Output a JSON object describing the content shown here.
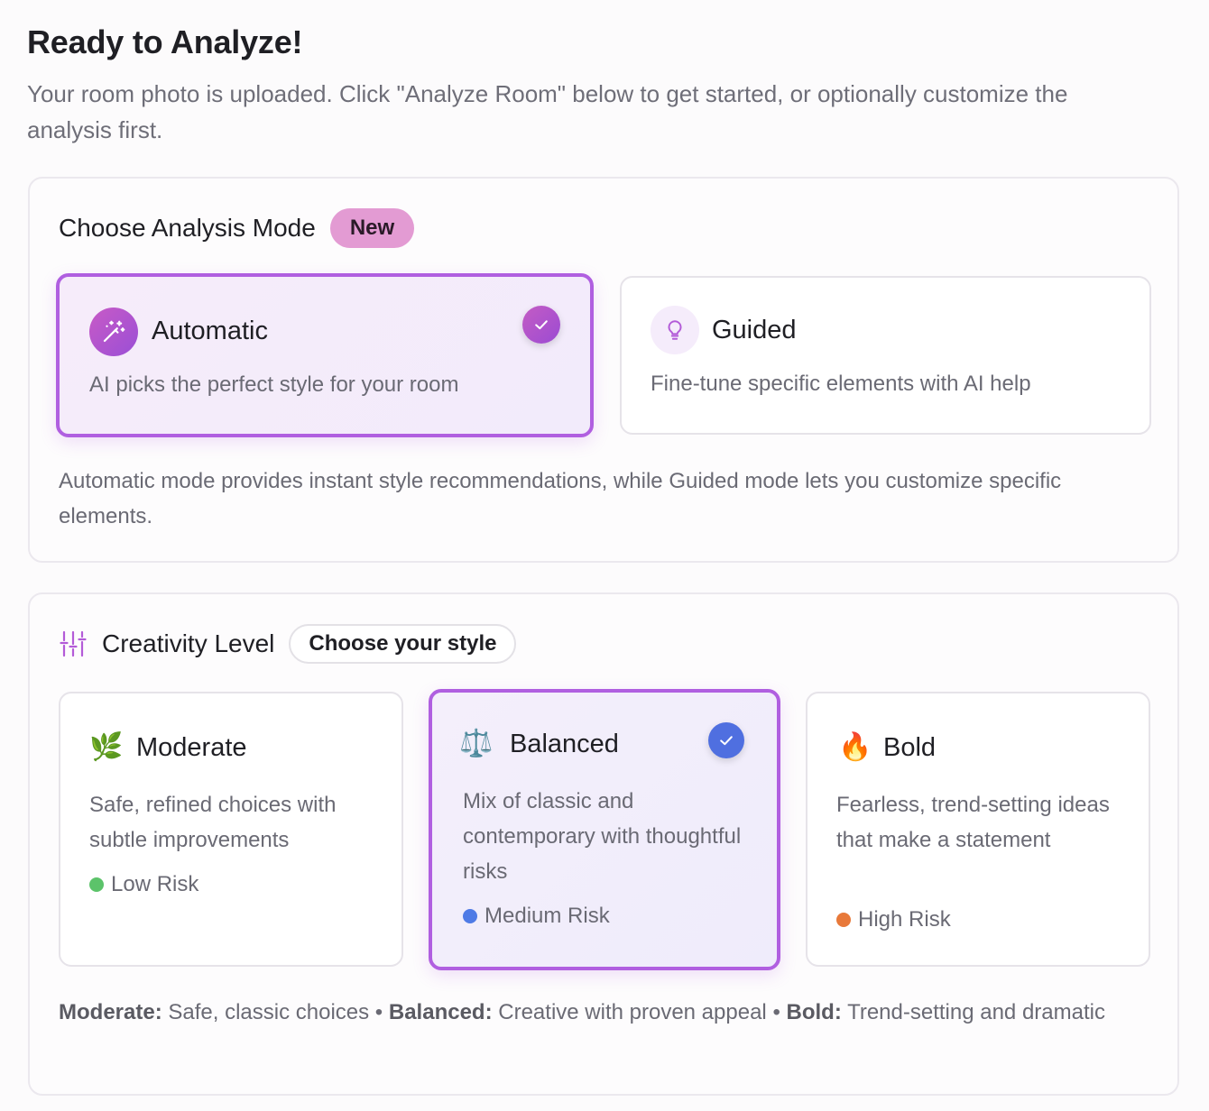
{
  "header": {
    "title": "Ready to Analyze!",
    "subtitle": "Your room photo is uploaded. Click \"Analyze Room\" below to get started, or optionally customize the analysis first."
  },
  "analysis_mode": {
    "title": "Choose Analysis Mode",
    "badge": "New",
    "options": [
      {
        "label": "Automatic",
        "description": "AI picks the perfect style for your room",
        "icon": "magic-wand-icon",
        "selected": true
      },
      {
        "label": "Guided",
        "description": "Fine-tune specific elements with AI help",
        "icon": "lightbulb-icon",
        "selected": false
      }
    ],
    "note": "Automatic mode provides instant style recommendations, while Guided mode lets you customize specific elements."
  },
  "creativity": {
    "title": "Creativity Level",
    "badge": "Choose your style",
    "icon": "sliders-icon",
    "levels": [
      {
        "label": "Moderate",
        "emoji": "🌿",
        "description": "Safe, refined choices with subtle improvements",
        "risk": "Low Risk",
        "risk_color": "#5cc36a",
        "selected": false
      },
      {
        "label": "Balanced",
        "emoji": "⚖️",
        "description": "Mix of classic and contemporary with thoughtful risks",
        "risk": "Medium Risk",
        "risk_color": "#4f7be6",
        "selected": true
      },
      {
        "label": "Bold",
        "emoji": "🔥",
        "description": "Fearless, trend-setting ideas that make a statement",
        "risk": "High Risk",
        "risk_color": "#e8793a",
        "selected": false
      }
    ],
    "note": {
      "moderate_label": "Moderate:",
      "moderate_text": "Safe, classic choices",
      "separator": "•",
      "balanced_label": "Balanced:",
      "balanced_text": "Creative with proven appeal",
      "bold_label": "Bold:",
      "bold_text": "Trend-setting and dramatic"
    }
  },
  "colors": {
    "accent_purple": "#b05fe0",
    "badge_pink": "#e39bd3",
    "check_blue": "#4f6fe0"
  }
}
